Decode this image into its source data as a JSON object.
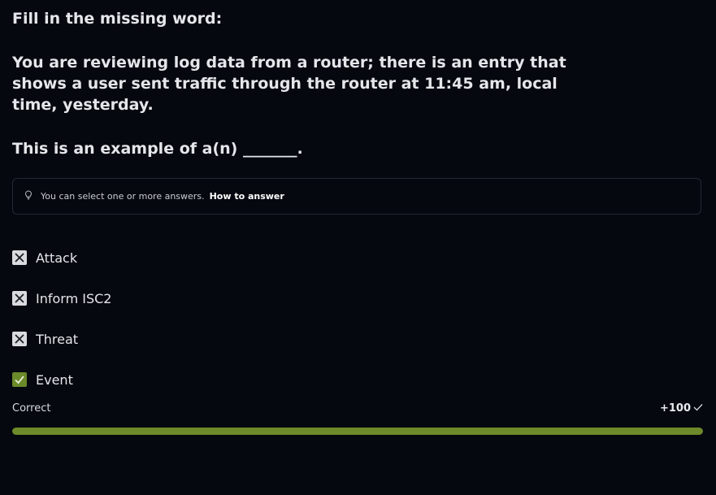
{
  "question": {
    "title": "Fill in the missing word:",
    "body": "You are reviewing log data from a router; there is an entry that shows a user sent traffic through the router at 11:45 am, local time, yesterday.",
    "prompt": "This is an example of a(n) _______."
  },
  "hint": {
    "text": "You can select one or more answers.",
    "link_label": "How to answer",
    "icon": "lightbulb-icon"
  },
  "options": [
    {
      "label": "Attack",
      "state": "incorrect",
      "icon": "x-icon"
    },
    {
      "label": "Inform ISC2",
      "state": "incorrect",
      "icon": "x-icon"
    },
    {
      "label": "Threat",
      "state": "incorrect",
      "icon": "x-icon"
    },
    {
      "label": "Event",
      "state": "correct",
      "icon": "check-icon"
    }
  ],
  "result": {
    "status": "Correct",
    "score": "+100",
    "score_icon": "check-icon",
    "progress_percent": 100
  },
  "colors": {
    "background": "#05080f",
    "correct_accent": "#6e8a2a",
    "text": "#e4e6ea"
  }
}
